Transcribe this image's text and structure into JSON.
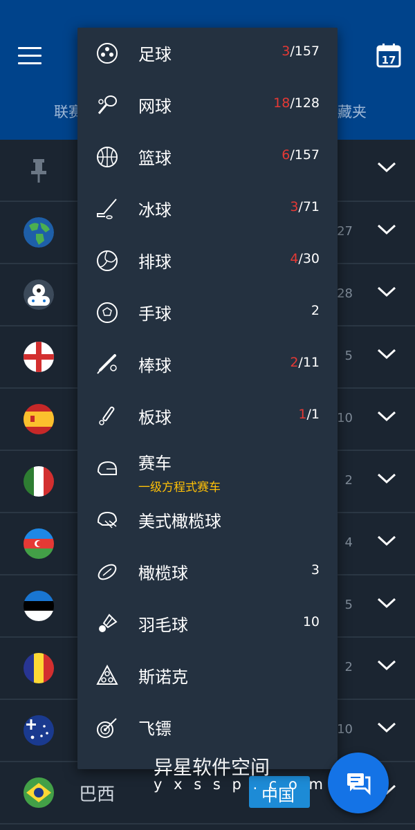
{
  "header": {
    "tab_left_partial": "联赛",
    "tab_right_partial": "藏夹",
    "calendar_day": "17"
  },
  "rows": [
    {
      "flag": "pin",
      "count": ""
    },
    {
      "flag": "world",
      "count": "27"
    },
    {
      "flag": "esports",
      "count": "28"
    },
    {
      "flag": "england",
      "count": "5"
    },
    {
      "flag": "spain",
      "count": "10"
    },
    {
      "flag": "italy",
      "count": "2"
    },
    {
      "flag": "azerbaijan",
      "count": "4"
    },
    {
      "flag": "estonia",
      "count": "5"
    },
    {
      "flag": "andorra",
      "count": "2"
    },
    {
      "flag": "australia",
      "count": "10"
    }
  ],
  "bottom_row": {
    "name": "巴西",
    "button": "中国"
  },
  "menu": [
    {
      "icon": "soccer-icon",
      "label": "足球",
      "live": "3",
      "total": "/157"
    },
    {
      "icon": "tennis-icon",
      "label": "网球",
      "live": "18",
      "total": "/128"
    },
    {
      "icon": "basketball-icon",
      "label": "篮球",
      "live": "6",
      "total": "/157"
    },
    {
      "icon": "hockey-icon",
      "label": "冰球",
      "live": "3",
      "total": "/71"
    },
    {
      "icon": "volleyball-icon",
      "label": "排球",
      "live": "4",
      "total": "/30"
    },
    {
      "icon": "handball-icon",
      "label": "手球",
      "live": "",
      "total": "2"
    },
    {
      "icon": "baseball-icon",
      "label": "棒球",
      "live": "2",
      "total": "/11"
    },
    {
      "icon": "cricket-icon",
      "label": "板球",
      "live": "1",
      "total": "/1"
    },
    {
      "icon": "motorsport-icon",
      "label": "赛车",
      "sub": "一级方程式赛车",
      "live": "",
      "total": ""
    },
    {
      "icon": "american-football-icon",
      "label": "美式橄榄球",
      "live": "",
      "total": ""
    },
    {
      "icon": "rugby-icon",
      "label": "橄榄球",
      "live": "",
      "total": "3"
    },
    {
      "icon": "badminton-icon",
      "label": "羽毛球",
      "live": "",
      "total": "10"
    },
    {
      "icon": "snooker-icon",
      "label": "斯诺克",
      "live": "",
      "total": ""
    },
    {
      "icon": "darts-icon",
      "label": "飞镖",
      "live": "",
      "total": ""
    }
  ],
  "watermark": {
    "title": "异星软件空间",
    "url": "y x s s p . c o m"
  },
  "colors": {
    "header": "#00438b",
    "menu_bg": "#243140",
    "live": "#e53935",
    "sub": "#ffc107",
    "fab": "#1473e6"
  }
}
